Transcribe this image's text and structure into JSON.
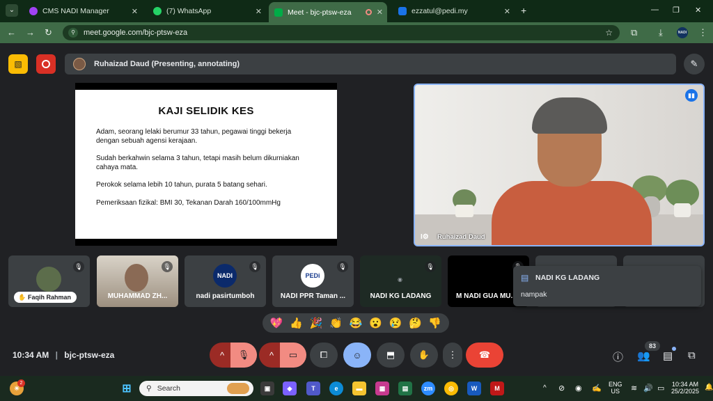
{
  "browser": {
    "tabs": [
      {
        "title": "CMS NADI Manager",
        "icon_color": "#a142f4",
        "active": false
      },
      {
        "title": "(7) WhatsApp",
        "icon_color": "#25d366",
        "active": false
      },
      {
        "title": "Meet - bjc-ptsw-eza",
        "icon_color": "#00ac47",
        "active": true
      },
      {
        "title": "ezzatul@pedi.my",
        "icon_color": "#1a73e8",
        "active": false
      }
    ],
    "url": "meet.google.com/bjc-ptsw-eza",
    "profile_initials": "NADI"
  },
  "meet": {
    "presenter_label": "Ruhaizad Daud (Presenting, annotating)",
    "slide": {
      "title": "KAJI SELIDIK KES",
      "paragraphs": [
        "Adam, seorang lelaki berumur 33 tahun, pegawai tinggi bekerja dengan sebuah agensi kerajaan.",
        "Sudah berkahwin selama 3 tahun, tetapi masih belum dikurniakan cahaya mata.",
        "Perokok selama lebih 10 tahun, purata 5 batang sehari.",
        "Pemeriksaan fizikal: BMI 30, Tekanan Darah 160/100mmHg"
      ]
    },
    "speaker_name": "Ruhaizad Daud",
    "participants": [
      {
        "name": "Faqih Rahman"
      },
      {
        "name": "MUHAMMAD ZH..."
      },
      {
        "name": "nadi pasirtumboh",
        "logo": "NADI"
      },
      {
        "name": "NADI PPR Taman ...",
        "logo": "PEDi"
      },
      {
        "name": "NADI KG LADANG"
      },
      {
        "name": "M NADI GUA MU..."
      }
    ],
    "chat_toast": {
      "sender": "NADI KG LADANG",
      "message": "nampak"
    },
    "reactions": [
      "💖",
      "👍",
      "🎉",
      "👏",
      "😂",
      "😮",
      "😢",
      "🤔",
      "👎"
    ],
    "time": "10:34 AM",
    "meeting_code": "bjc-ptsw-eza",
    "people_count": "83"
  },
  "taskbar": {
    "search_placeholder": "Search",
    "notification_count": "2",
    "lang_line1": "ENG",
    "lang_line2": "US",
    "clock_time": "10:34 AM",
    "clock_date": "25/2/2025"
  }
}
